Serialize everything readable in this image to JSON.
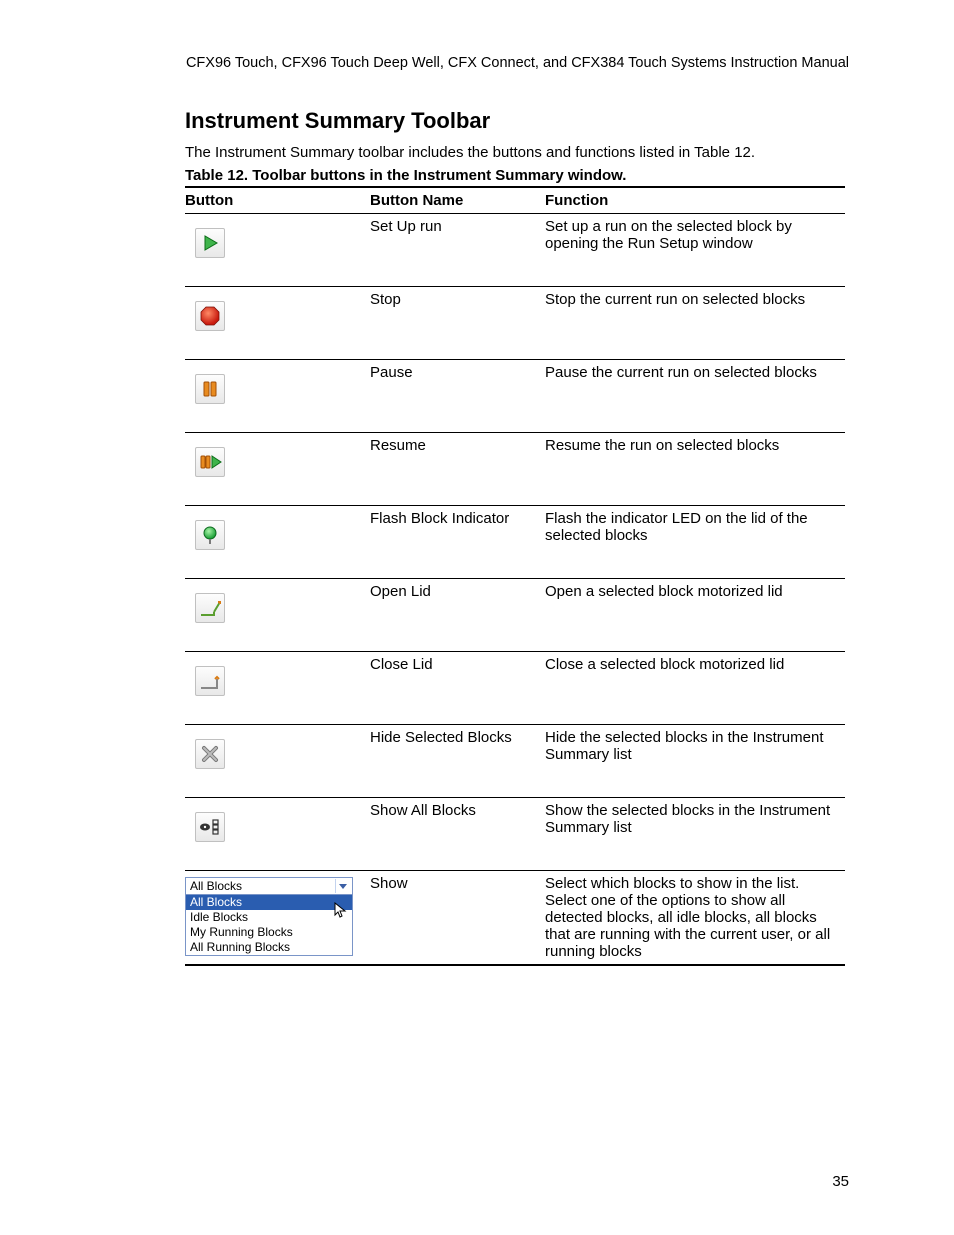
{
  "running_head": "CFX96 Touch, CFX96 Touch Deep Well, CFX Connect, and CFX384 Touch Systems Instruction Manual",
  "section_title": "Instrument Summary Toolbar",
  "intro_text": "The Instrument Summary toolbar includes the buttons and functions listed in Table 12.",
  "table_caption": "Table 12. Toolbar buttons in the Instrument Summary window.",
  "columns": {
    "button": "Button",
    "name": "Button Name",
    "func": "Function"
  },
  "rows": [
    {
      "icon": "play",
      "name": "Set Up run",
      "func": "Set up a run on the selected block by opening the Run Setup window"
    },
    {
      "icon": "stop",
      "name": "Stop",
      "func": "Stop the current run on selected blocks"
    },
    {
      "icon": "pause",
      "name": "Pause",
      "func": "Pause the current run on selected blocks"
    },
    {
      "icon": "resume",
      "name": "Resume",
      "func": "Resume the run on selected blocks"
    },
    {
      "icon": "indicator",
      "name": "Flash Block Indicator",
      "func": "Flash the indicator LED on the lid of the selected blocks"
    },
    {
      "icon": "open-lid",
      "name": "Open Lid",
      "func": "Open a selected block motorized lid"
    },
    {
      "icon": "close-lid",
      "name": "Close Lid",
      "func": "Close a selected block motorized lid"
    },
    {
      "icon": "hide",
      "name": "Hide Selected Blocks",
      "func": "Hide the selected blocks in the Instrument Summary list"
    },
    {
      "icon": "show-all",
      "name": "Show All Blocks",
      "func": "Show the selected blocks in the Instrument Summary list"
    },
    {
      "icon": "dropdown",
      "name": "Show",
      "func": "Select which blocks to show in the list. Select one of the options to show all detected blocks, all idle blocks, all blocks that are running with the current user, or all running blocks"
    }
  ],
  "dropdown": {
    "selected": "All Blocks",
    "options": [
      "All Blocks",
      "Idle Blocks",
      "My Running Blocks",
      "All Running Blocks"
    ]
  },
  "page_number": "35"
}
